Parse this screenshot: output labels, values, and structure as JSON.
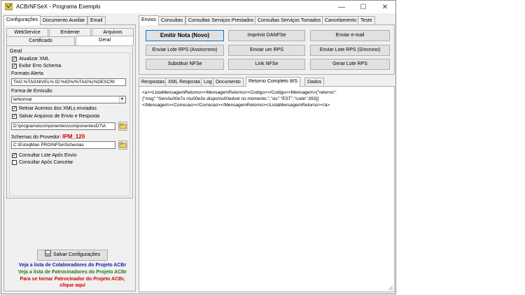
{
  "window": {
    "title": "ACBrNFSeX - Programa Exemplo",
    "minimize_glyph": "—",
    "maximize_glyph": "☐",
    "close_glyph": "✕"
  },
  "left_tabs": [
    "Configurações",
    "Documento Auxiliar",
    "Email"
  ],
  "config_subtabs": {
    "row1": [
      "WebService",
      "Emitente",
      "Arquivos"
    ],
    "row2": [
      "Certificado",
      "Geral"
    ]
  },
  "geral": {
    "group_title": "Geral",
    "atualizar_xml": "Atualizar XML",
    "exibir_erro": "Exibir Erro Schema",
    "formato_alerta_label": "Formato Alerta",
    "formato_alerta_value": "TAG:%TAGNIVEL% ID:%ID%/%TAG%(%DESCRI",
    "forma_emissao_label": "Forma de Emissão",
    "forma_emissao_value": "teNormal",
    "retirar_acentos": "Retirar Acentos dos XMLs enviados",
    "salvar_arquivos": "Salvar Arquivos de Envio e Resposta",
    "path_value": "D:\\programa\\componentes\\componentesD7\\A",
    "schemas_label": "Schemas do Provedor:",
    "schemas_provider": "IPM_120",
    "schemas_value": "C:\\EstoqMan PRO\\NFSe\\Schemas",
    "consultar_lote": "Consultar Lote Após Envio",
    "consultar_cancelar": "Consultar Após Cancelar"
  },
  "save_button": "Salvar Configurações",
  "links": {
    "colaboradores": "Veja a lista de Colaboradores do Projeto ACBr",
    "patrocinadores": "Veja a lista de Patrocinadores do Projeto ACBr",
    "patrocinador_line1": "Para se tornar Patrocinador do Projeto ACBr,",
    "patrocinador_line2": "clique aqui"
  },
  "right_tabs": [
    "Envios",
    "Consultas",
    "Consultas Serviços Prestados",
    "Consultas Serviços Tomados",
    "Cancelamento",
    "Teste"
  ],
  "actions": [
    "Emitir Nota (Novo)",
    "Imprimir DANFSe",
    "Enviar e-mail",
    "Enviar Lote RPS (Assincrono)",
    "Enviar um RPS",
    "Enviar Lote RPS (Síncrono)",
    "Substituir NFSe",
    "Link NFSe",
    "Gerar Lote RPS"
  ],
  "bottom_tabs": [
    "Respostas",
    "XML Resposta",
    "Log",
    "Documento",
    "Retorno Completo WS",
    "Dados"
  ],
  "memo": {
    "line1": "<a><ListaMensagemRetorno><MensagemRetorno><Codigo></Codigo><Mensagem>{\"retorno\":",
    "line2": "{\"msg\":\"Servi\\u00e7o n\\u00e3o dispon\\u00edvel no momento.\",\"sis\":\"EST\",\"code\":393}}",
    "line3": "</Mensagem><Correcao></Correcao></MensagemRetorno></ListaMensagemRetorno></a>"
  },
  "colors": {
    "link_blue": "#1a1aa6",
    "link_green": "#1e7b1e",
    "link_red": "#d40000",
    "provider_red": "#cc0000",
    "accent": "#0078d7"
  }
}
